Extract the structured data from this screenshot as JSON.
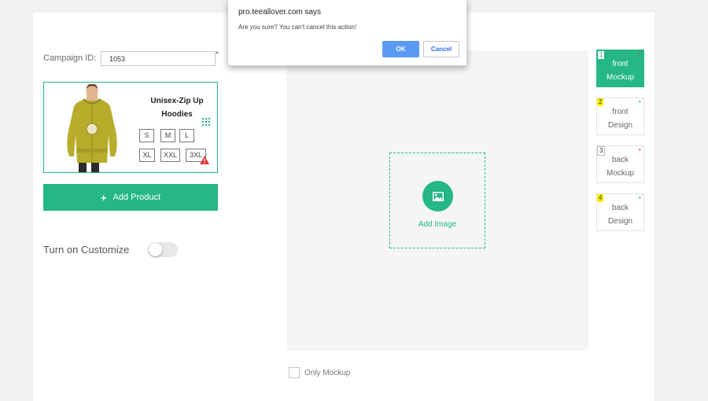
{
  "campaign": {
    "label": "Campaign ID:",
    "value": "1053",
    "required_mark": "*"
  },
  "product": {
    "title": "Unisex-Zip Up Hoodies",
    "image_icon": "hoodie-product-image",
    "sizes": [
      "S",
      "M",
      "L",
      "XL",
      "XXL",
      "3XL"
    ],
    "accent_color": "#25b784",
    "grid_icon": "grid-icon",
    "warning_icon": "warning-triangle-icon",
    "warning_color": "#e53935"
  },
  "add_product": {
    "icon": "+",
    "label": "Add Product"
  },
  "customize": {
    "label": "Turn on Customize",
    "enabled": false
  },
  "canvas": {
    "add_image_label": "Add Image",
    "image_icon": "image-icon"
  },
  "only_mockup": {
    "label": "Only Mockup",
    "checked": false
  },
  "views": [
    {
      "number": "1",
      "line1": "front",
      "line2": "Mockup",
      "star": "*",
      "star_color": "#e53935",
      "active": true
    },
    {
      "number": "2",
      "line1": "front",
      "line2": "Design",
      "star": "*",
      "star_color": "#25b784",
      "active": false
    },
    {
      "number": "3",
      "line1": "back",
      "line2": "Mockup",
      "star": "*",
      "star_color": "#e53935",
      "active": false
    },
    {
      "number": "4",
      "line1": "back",
      "line2": "Design",
      "star": "*",
      "star_color": "#25b784",
      "active": false
    }
  ],
  "dialog": {
    "title": "pro.teeallover.com says",
    "message": "Are you sure? You can't cancel this action!",
    "ok_label": "OK",
    "cancel_label": "Cancel"
  }
}
